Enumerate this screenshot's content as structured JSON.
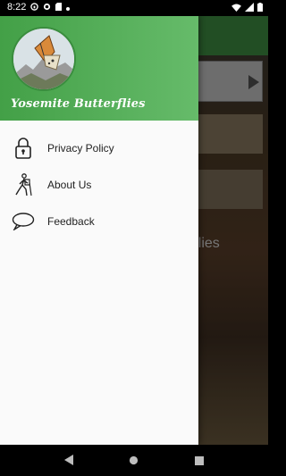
{
  "status_bar": {
    "time": "8:22",
    "icons_left": [
      "headset-icon",
      "sync-icon",
      "sd-card-icon",
      "dot-icon"
    ],
    "icons_right": [
      "wifi-icon",
      "signal-icon",
      "battery-icon"
    ]
  },
  "background_app": {
    "visible_text": "rflies"
  },
  "drawer": {
    "header": {
      "avatar_icon": "butterfly-logo",
      "title": "Yosemite Butterflies",
      "color_start": "#43a047",
      "color_end": "#66bb6a"
    },
    "items": [
      {
        "label": "Privacy Policy",
        "icon": "lock-icon"
      },
      {
        "label": "About Us",
        "icon": "hiker-icon"
      },
      {
        "label": "Feedback",
        "icon": "speech-bubble-icon"
      }
    ]
  },
  "nav_bar": {
    "buttons": [
      "back-icon",
      "home-icon",
      "recents-icon"
    ]
  }
}
